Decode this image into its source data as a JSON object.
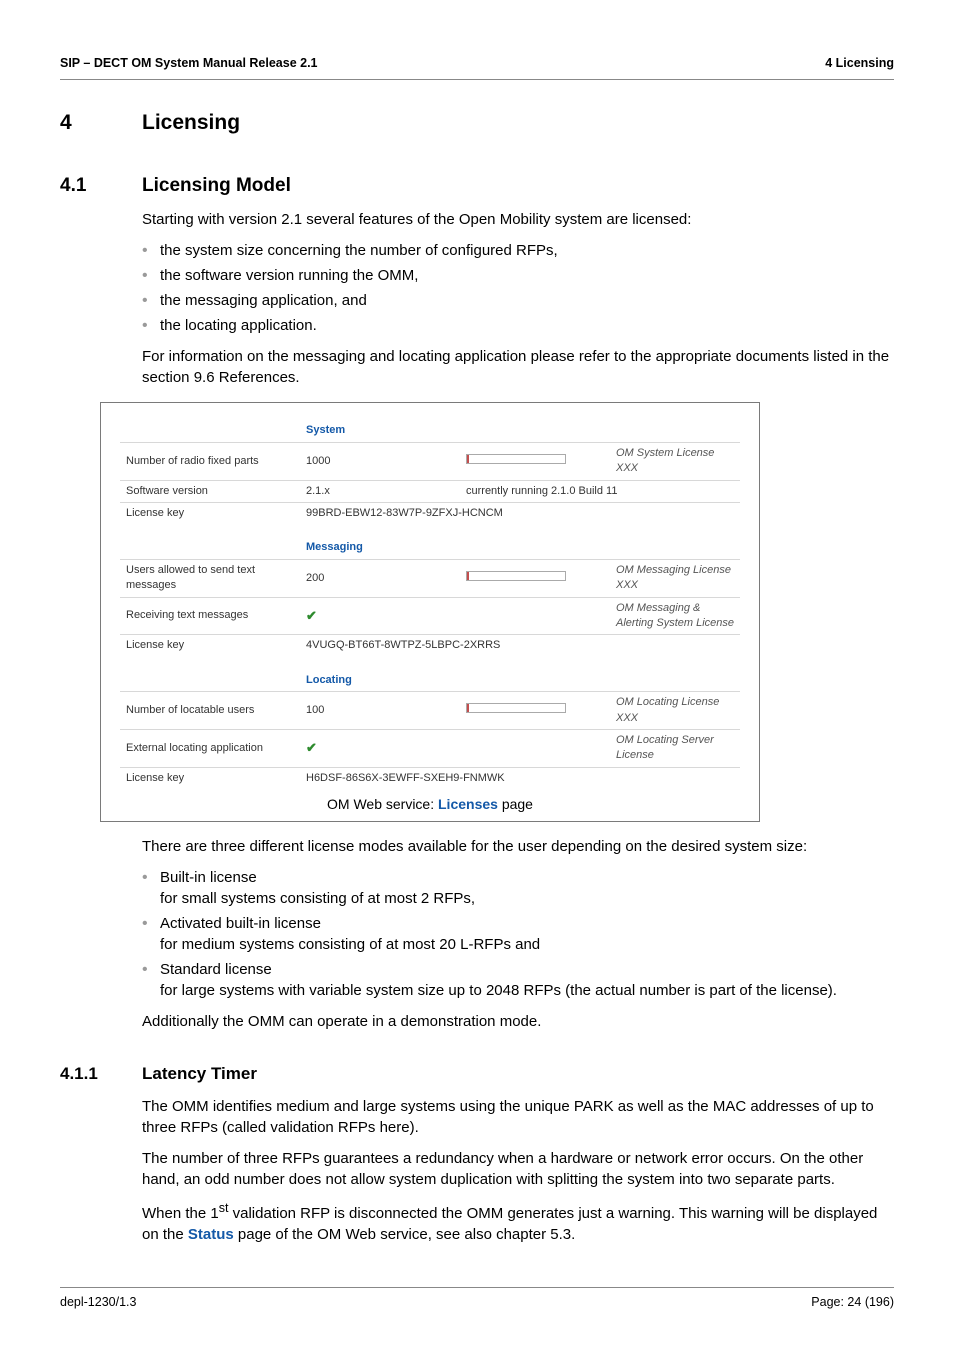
{
  "header": {
    "left": "SIP – DECT OM System Manual Release 2.1",
    "right": "4 Licensing"
  },
  "h1": {
    "num": "4",
    "title": "Licensing"
  },
  "h2": {
    "num": "4.1",
    "title": "Licensing Model"
  },
  "intro_para": "Starting with version 2.1 several features of the Open Mobility system are licensed:",
  "bullets1": [
    "the system size concerning the number of configured RFPs,",
    "the software version running the OMM,",
    "the messaging application, and",
    "the locating application."
  ],
  "para2": "For information on the messaging and locating application please refer to the appropriate documents listed in the section 9.6 References.",
  "figure": {
    "sections": [
      {
        "name": "System",
        "rows": [
          {
            "label": "Number of radio fixed parts",
            "value": "1000",
            "bar_pct": 2,
            "right": "OM System License XXX"
          },
          {
            "label": "Software version",
            "value": "2.1.x",
            "mid": "currently running 2.1.0 Build 11",
            "right": ""
          },
          {
            "label": "License key",
            "value": "99BRD-EBW12-83W7P-9ZFXJ-HCNCM",
            "span": true
          }
        ]
      },
      {
        "name": "Messaging",
        "rows": [
          {
            "label": "Users allowed to send text messages",
            "value": "200",
            "bar_pct": 2,
            "right": "OM Messaging License XXX"
          },
          {
            "label": "Receiving text messages",
            "check": true,
            "right": "OM Messaging & Alerting System License"
          },
          {
            "label": "License key",
            "value": "4VUGQ-BT66T-8WTPZ-5LBPC-2XRRS",
            "span": true
          }
        ]
      },
      {
        "name": "Locating",
        "rows": [
          {
            "label": "Number of locatable users",
            "value": "100",
            "bar_pct": 2,
            "right": "OM Locating License XXX"
          },
          {
            "label": "External locating application",
            "check": true,
            "right": "OM Locating Server License"
          },
          {
            "label": "License key",
            "value": "H6DSF-86S6X-3EWFF-SXEH9-FNMWK",
            "span": true
          }
        ]
      }
    ],
    "caption_prefix": "OM Web service: ",
    "caption_link": "Licenses",
    "caption_suffix": " page"
  },
  "para3": "There are three different license modes available for the user depending on the desired system size:",
  "bullets2": [
    {
      "head": "Built-in license",
      "body": "for small systems consisting of at most 2 RFPs,"
    },
    {
      "head": "Activated built-in license",
      "body": "for medium systems consisting of at most 20 L-RFPs and"
    },
    {
      "head": "Standard license",
      "body": "for large systems with variable system size up to 2048 RFPs (the actual number is part of the license)."
    }
  ],
  "para4": "Additionally the OMM can operate in a demonstration mode.",
  "h3": {
    "num": "4.1.1",
    "title": "Latency Timer"
  },
  "para5": "The OMM identifies medium and large systems using the unique PARK as well as the MAC addresses of up to three RFPs (called validation RFPs here).",
  "para6": "The number of three RFPs guarantees a redundancy when a hardware or network error occurs. On the other hand, an odd number does not allow system duplication with splitting the system into two separate parts.",
  "para7_a": "When the 1",
  "para7_sup": "st",
  "para7_b": " validation RFP is disconnected the OMM generates just a warning. This warning will be displayed on the ",
  "para7_link": "Status",
  "para7_c": " page of the OM Web service, see also chapter 5.3.",
  "footer": {
    "left": "depl-1230/1.3",
    "right": "Page: 24 (196)"
  }
}
